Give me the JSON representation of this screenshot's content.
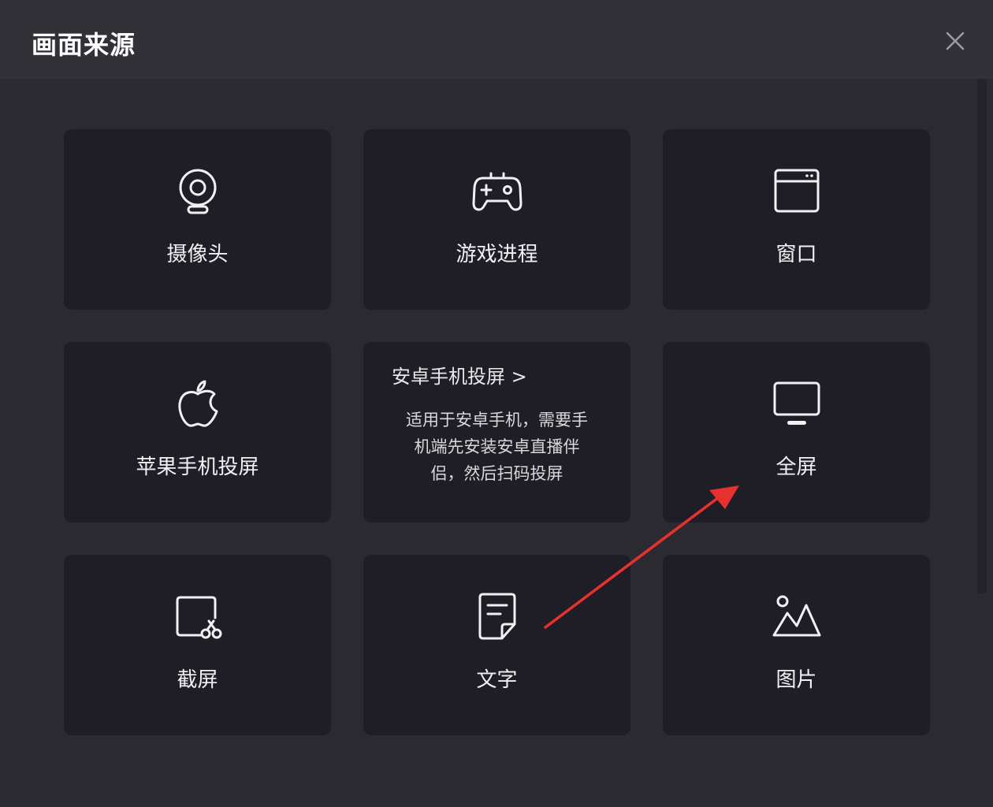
{
  "dialog": {
    "title": "画面来源",
    "close_icon": "close-icon"
  },
  "cards": [
    {
      "label": "摄像头",
      "icon": "webcam-icon"
    },
    {
      "label": "游戏进程",
      "icon": "gamepad-icon"
    },
    {
      "label": "窗口",
      "icon": "window-icon"
    },
    {
      "label": "苹果手机投屏",
      "icon": "apple-icon"
    },
    {
      "title": "安卓手机投屏 >",
      "description_lines": [
        "适用于安卓手机，需要手",
        "机端先安装安卓直播伴",
        "侣，然后扫码投屏"
      ]
    },
    {
      "label": "全屏",
      "icon": "monitor-icon"
    },
    {
      "label": "截屏",
      "icon": "screenshot-icon"
    },
    {
      "label": "文字",
      "icon": "text-note-icon"
    },
    {
      "label": "图片",
      "icon": "image-icon"
    }
  ],
  "colors": {
    "background": "#2b2a31",
    "titlebar": "#323138",
    "card": "#1f1e26",
    "annotation_arrow": "#e8302f"
  }
}
